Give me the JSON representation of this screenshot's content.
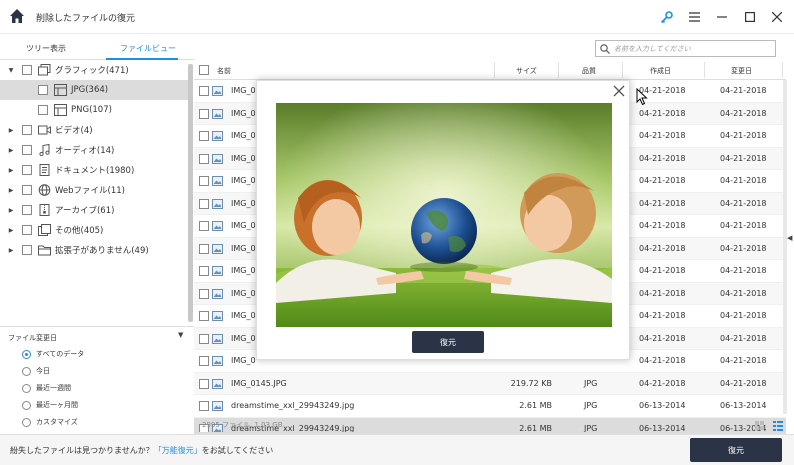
{
  "app": {
    "title": "削除したファイルの復元"
  },
  "tabs": [
    {
      "label": "ツリー表示"
    },
    {
      "label": "ファイルビュー"
    }
  ],
  "tree": [
    {
      "label": "グラフィック(471)",
      "icon": "graphic-icon",
      "expanded": true
    },
    {
      "label": "JPG(364)",
      "icon": "image-file-icon",
      "selected": true
    },
    {
      "label": "PNG(107)",
      "icon": "image-file-icon"
    },
    {
      "label": "ビデオ(4)",
      "icon": "video-icon"
    },
    {
      "label": "オーディオ(14)",
      "icon": "music-icon"
    },
    {
      "label": "ドキュメント(1980)",
      "icon": "document-icon"
    },
    {
      "label": "Webファイル(11)",
      "icon": "globe-icon"
    },
    {
      "label": "アーカイブ(61)",
      "icon": "archive-icon"
    },
    {
      "label": "その他(405)",
      "icon": "other-icon"
    },
    {
      "label": "拡張子がありません(49)",
      "icon": "folder-icon"
    }
  ],
  "filter": {
    "title": "ファイル変更日",
    "options": [
      "すべてのデータ",
      "今日",
      "最近一週間",
      "最近一ヶ月間",
      "カスタマイズ"
    ],
    "selected": 0
  },
  "search": {
    "placeholder": "名前を入力してください"
  },
  "table": {
    "headers": {
      "name": "名前",
      "size": "サイズ",
      "type": "品質",
      "created": "作成日",
      "modified": "変更日"
    },
    "rows": [
      {
        "name": "IMG_0",
        "size": "",
        "type": "",
        "created": "04-21-2018",
        "modified": "04-21-2018"
      },
      {
        "name": "IMG_0",
        "size": "",
        "type": "",
        "created": "04-21-2018",
        "modified": "04-21-2018"
      },
      {
        "name": "IMG_0",
        "size": "",
        "type": "",
        "created": "04-21-2018",
        "modified": "04-21-2018"
      },
      {
        "name": "IMG_0",
        "size": "",
        "type": "",
        "created": "04-21-2018",
        "modified": "04-21-2018"
      },
      {
        "name": "IMG_0",
        "size": "",
        "type": "",
        "created": "04-21-2018",
        "modified": "04-21-2018"
      },
      {
        "name": "IMG_0",
        "size": "",
        "type": "",
        "created": "04-21-2018",
        "modified": "04-21-2018"
      },
      {
        "name": "IMG_0",
        "size": "",
        "type": "",
        "created": "04-21-2018",
        "modified": "04-21-2018"
      },
      {
        "name": "IMG_0",
        "size": "",
        "type": "",
        "created": "04-21-2018",
        "modified": "04-21-2018"
      },
      {
        "name": "IMG_0",
        "size": "",
        "type": "",
        "created": "04-21-2018",
        "modified": "04-21-2018"
      },
      {
        "name": "IMG_0",
        "size": "",
        "type": "",
        "created": "04-21-2018",
        "modified": "04-21-2018"
      },
      {
        "name": "IMG_0",
        "size": "",
        "type": "",
        "created": "04-21-2018",
        "modified": "04-21-2018"
      },
      {
        "name": "IMG_0",
        "size": "",
        "type": "",
        "created": "04-21-2018",
        "modified": "04-21-2018"
      },
      {
        "name": "IMG_0",
        "size": "",
        "type": "",
        "created": "04-21-2018",
        "modified": "04-21-2018"
      },
      {
        "name": "IMG_0145.JPG",
        "size": "219.72 KB",
        "type": "JPG",
        "created": "04-21-2018",
        "modified": "04-21-2018"
      },
      {
        "name": "dreamstime_xxl_29943249.jpg",
        "size": "2.61 MB",
        "type": "JPG",
        "created": "06-13-2014",
        "modified": "06-13-2014"
      },
      {
        "name": "dreamstime_xxl_29943249.jpg",
        "size": "2.61 MB",
        "type": "JPG",
        "created": "06-13-2014",
        "modified": "06-13-2014",
        "highlight": true
      }
    ]
  },
  "status": {
    "text": "2995 ファイル, 1.03 GB"
  },
  "footer": {
    "text_before": "紛失したファイルは見つかりませんか？",
    "link": "「万能復元」",
    "text_after": "をお試してください",
    "recover_label": "復元"
  },
  "preview": {
    "recover_label": "復元"
  },
  "colors": {
    "accent": "#1e90e0",
    "button_dark": "#2b3447"
  }
}
